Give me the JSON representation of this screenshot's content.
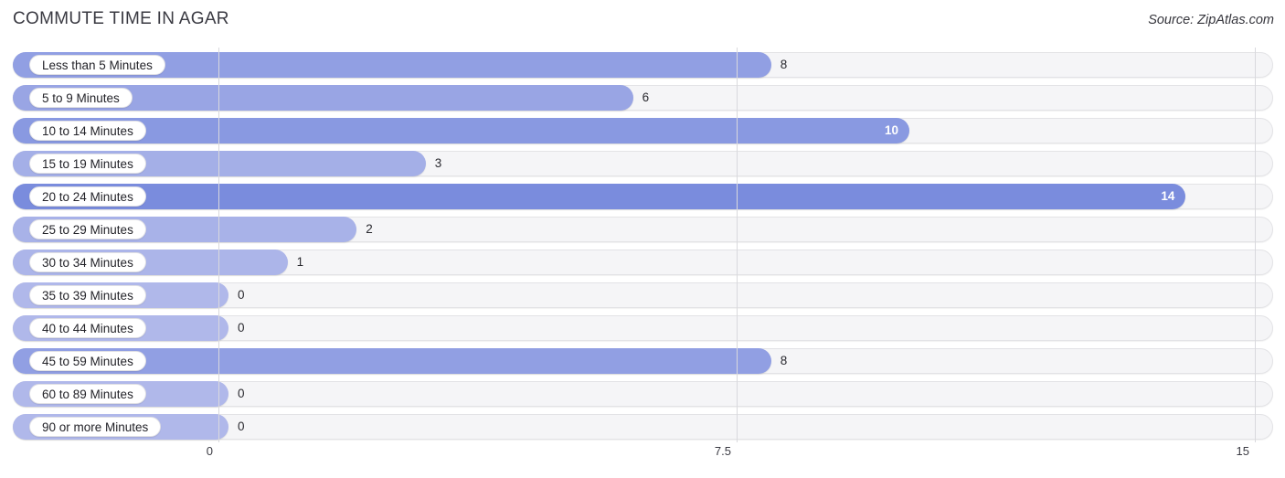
{
  "header": {
    "title": "COMMUTE TIME IN AGAR",
    "source": "Source: ZipAtlas.com"
  },
  "chart_data": {
    "type": "bar",
    "orientation": "horizontal",
    "title": "COMMUTE TIME IN AGAR",
    "xlabel": "",
    "ylabel": "",
    "xlim": [
      0,
      15
    ],
    "ticks": [
      "0",
      "7.5",
      "15"
    ],
    "tick_values": [
      0,
      7.5,
      15
    ],
    "grid": true,
    "legend": false,
    "categories": [
      "Less than 5 Minutes",
      "5 to 9 Minutes",
      "10 to 14 Minutes",
      "15 to 19 Minutes",
      "20 to 24 Minutes",
      "25 to 29 Minutes",
      "30 to 34 Minutes",
      "35 to 39 Minutes",
      "40 to 44 Minutes",
      "45 to 59 Minutes",
      "60 to 89 Minutes",
      "90 or more Minutes"
    ],
    "values": [
      8,
      6,
      10,
      3,
      14,
      2,
      1,
      0,
      0,
      8,
      0,
      0
    ],
    "value_labels": [
      "8",
      "6",
      "10",
      "3",
      "14",
      "2",
      "1",
      "0",
      "0",
      "8",
      "0",
      "0"
    ],
    "bar_color_light": "#b0b8ea",
    "bar_color_dark": "#7a8cdd",
    "track_color": "#f5f5f7"
  }
}
